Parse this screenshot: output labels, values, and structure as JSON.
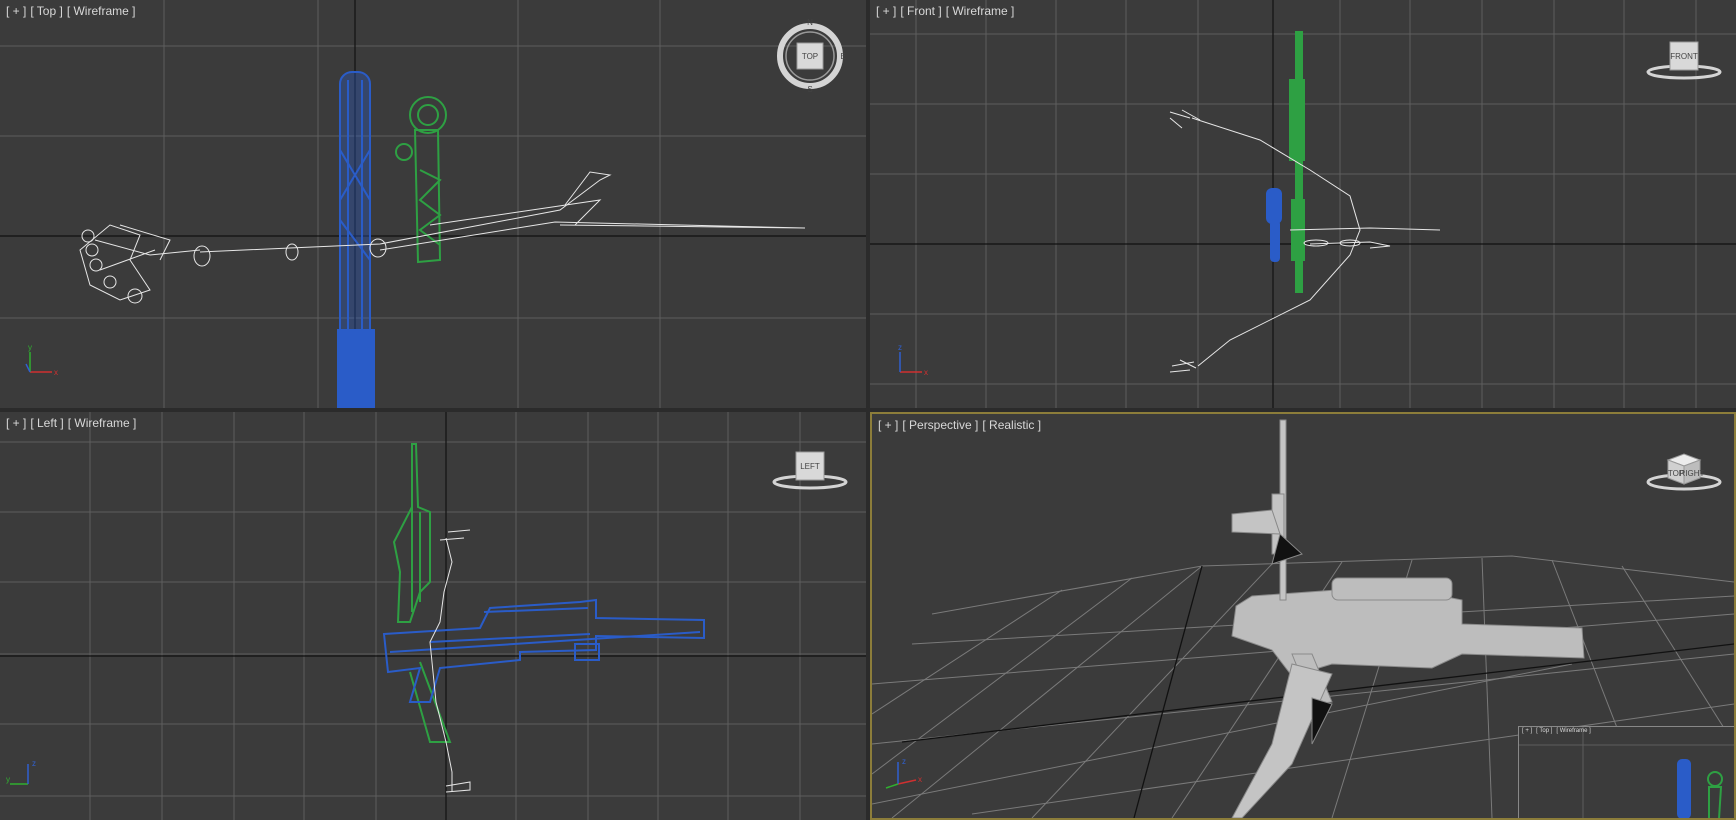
{
  "viewports": {
    "top": {
      "menu": "[ + ]",
      "view": "[ Top ]",
      "shading": "[ Wireframe ]",
      "cube": "TOP",
      "compass": {
        "n": "N",
        "e": "E",
        "s": "S"
      }
    },
    "front": {
      "menu": "[ + ]",
      "view": "[ Front ]",
      "shading": "[ Wireframe ]",
      "cube": "FRONT"
    },
    "left": {
      "menu": "[ + ]",
      "view": "[ Left ]",
      "shading": "[ Wireframe ]",
      "cube": "LEFT"
    },
    "perspective": {
      "menu": "[ + ]",
      "view": "[ Perspective ]",
      "shading": "[ Realistic ]",
      "cube_faces": [
        "TOP",
        "RIGHT"
      ]
    },
    "mini": {
      "menu": "[ + ]",
      "view": "[ Top ]",
      "shading": "[ Wireframe ]"
    }
  },
  "axes": {
    "x": "x",
    "y": "y",
    "z": "z"
  },
  "colors": {
    "viewport_bg": "#3b3b3b",
    "grid": "#5e5e5e",
    "home_axis": "#111111",
    "active_border": "#8c7d3a",
    "bow_object": "#2ea043",
    "rifle_object": "#2a5cc8",
    "bone_wireframe": "#e6e6e6"
  }
}
